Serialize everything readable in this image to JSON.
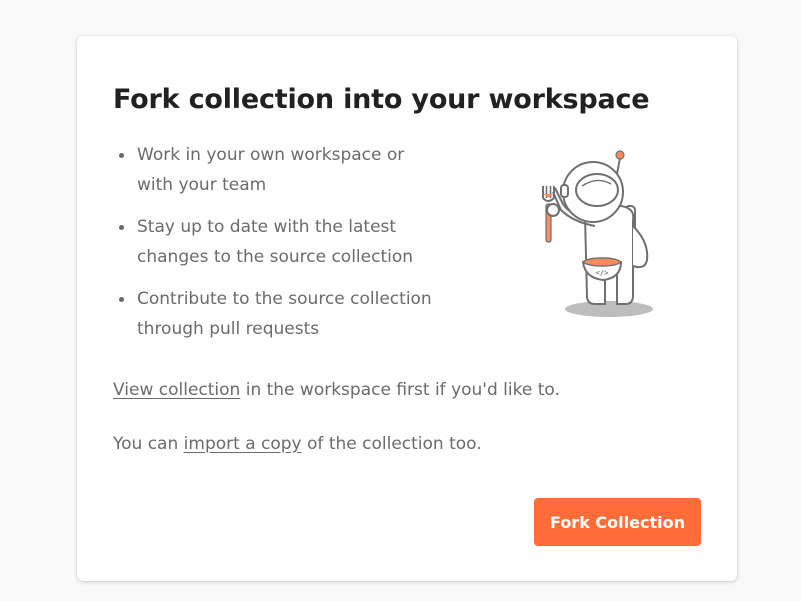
{
  "dialog": {
    "title": "Fork collection into your workspace",
    "features": [
      {
        "line1": "Work in your own workspace or",
        "line2": "with your team"
      },
      {
        "line1": "Stay up to date with the latest",
        "line2": "changes to the source collection"
      },
      {
        "line1": "Contribute to the source collection",
        "line2": "through pull requests"
      }
    ],
    "illustration_icon": "astronaut-with-fork-and-bowl",
    "view_link": "View collection",
    "view_suffix": " in the workspace first if you'd like to.",
    "import_prefix": "You can ",
    "import_link": "import a copy",
    "import_suffix": " of the collection too.",
    "fork_button": "Fork Collection",
    "accent_color": "#ff6c37"
  }
}
